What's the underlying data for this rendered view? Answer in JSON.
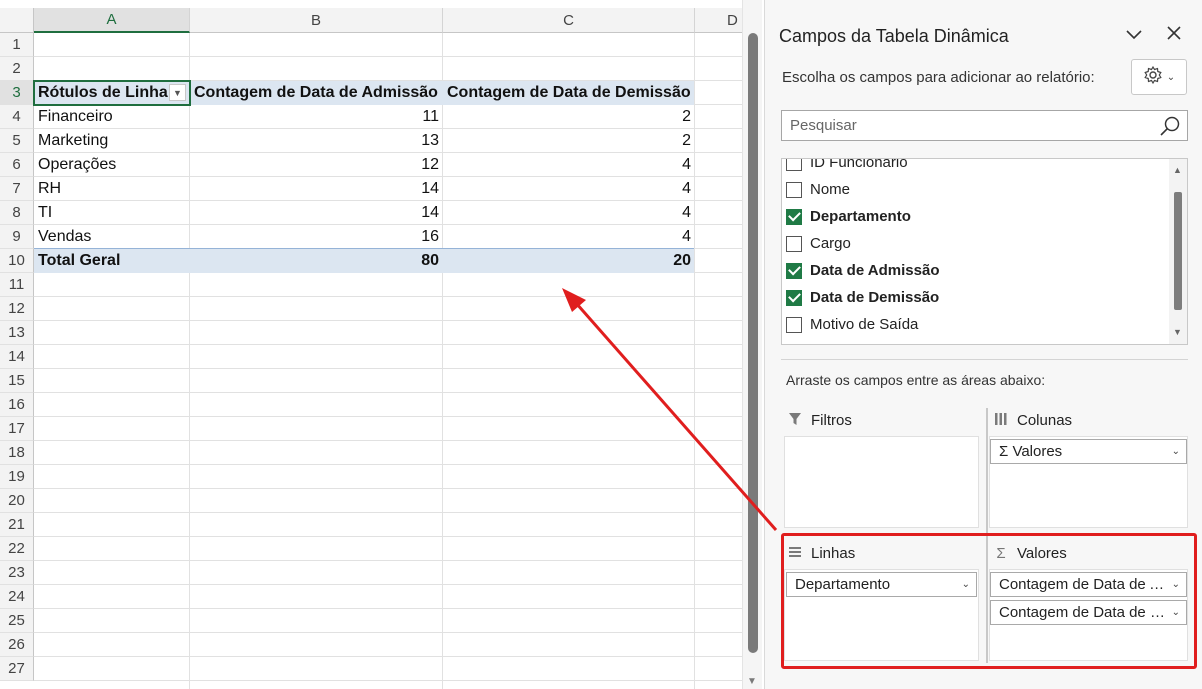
{
  "sheet": {
    "columns": [
      "A",
      "B",
      "C",
      "D"
    ],
    "rows": [
      "1",
      "2",
      "3",
      "4",
      "5",
      "6",
      "7",
      "8",
      "9",
      "10",
      "11",
      "12",
      "13",
      "14",
      "15",
      "16",
      "17",
      "18",
      "19",
      "20",
      "21",
      "22",
      "23",
      "24",
      "25",
      "26",
      "27"
    ],
    "pivot": {
      "header": [
        "Rótulos de Linha",
        "Contagem de Data de Admissão",
        "Contagem de Data de Demissão"
      ],
      "data": [
        [
          "Financeiro",
          "11",
          "2"
        ],
        [
          "Marketing",
          "13",
          "2"
        ],
        [
          "Operações",
          "12",
          "4"
        ],
        [
          "RH",
          "14",
          "4"
        ],
        [
          "TI",
          "14",
          "4"
        ],
        [
          "Vendas",
          "16",
          "4"
        ]
      ],
      "total": [
        "Total Geral",
        "80",
        "20"
      ]
    }
  },
  "pane": {
    "title": "Campos da Tabela Dinâmica",
    "subtitle": "Escolha os campos para adicionar ao relatório:",
    "search_placeholder": "Pesquisar",
    "fields": [
      {
        "label": "ID Funcionário",
        "checked": false
      },
      {
        "label": "Nome",
        "checked": false
      },
      {
        "label": "Departamento",
        "checked": true
      },
      {
        "label": "Cargo",
        "checked": false
      },
      {
        "label": "Data de Admissão",
        "checked": true
      },
      {
        "label": "Data de Demissão",
        "checked": true
      },
      {
        "label": "Motivo de Saída",
        "checked": false
      }
    ],
    "drag_hint": "Arraste os campos entre as áreas abaixo:",
    "areas": {
      "filters": {
        "label": "Filtros",
        "items": []
      },
      "columns": {
        "label": "Colunas",
        "items": [
          "Σ  Valores"
        ]
      },
      "rows": {
        "label": "Linhas",
        "items": [
          "Departamento"
        ]
      },
      "values": {
        "label": "Valores",
        "items": [
          "Contagem de Data de Admissão",
          "Contagem de Data de Demissão"
        ]
      }
    }
  },
  "colors": {
    "accent": "#1f7a45",
    "highlight": "#e01e1e",
    "pivot_band": "#dce6f1"
  }
}
